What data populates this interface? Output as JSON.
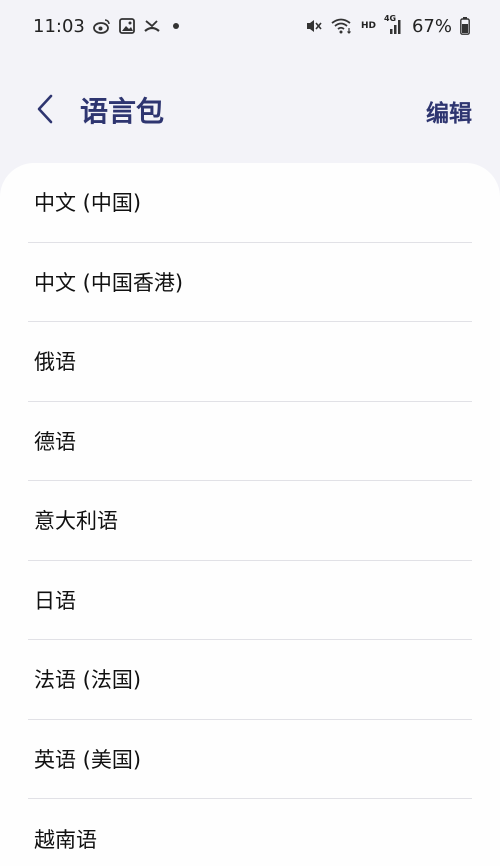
{
  "status_bar": {
    "time": "11:03",
    "battery": "67%",
    "icons_left": [
      "weibo-icon",
      "image-icon",
      "missed-call-icon",
      "notification-dot-icon"
    ],
    "icons_right": [
      "mute-icon",
      "wifi-icon",
      "hd-icon",
      "signal-4g-icon",
      "battery-icon"
    ],
    "hd_label": "HD",
    "net_label": "4G"
  },
  "header": {
    "title": "语言包",
    "edit_label": "编辑"
  },
  "languages": [
    "中文 (中国)",
    "中文 (中国香港)",
    "俄语",
    "德语",
    "意大利语",
    "日语",
    "法语 (法国)",
    "英语 (美国)",
    "越南语"
  ],
  "colors": {
    "background": "#f3f3f8",
    "accent": "#2e3570",
    "card": "#fefefe",
    "divider": "#e1e1e6"
  }
}
